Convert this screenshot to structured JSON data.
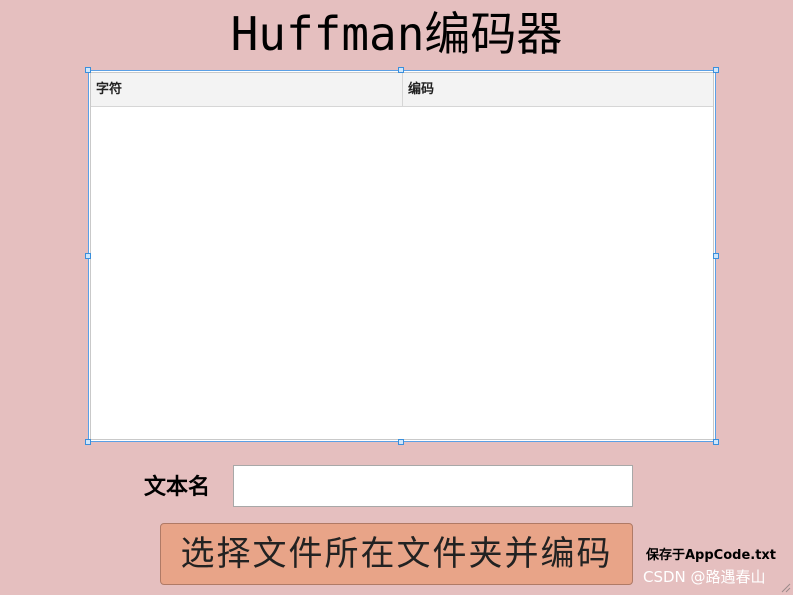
{
  "window": {
    "title": "Huffman编码器"
  },
  "table": {
    "columns": [
      "字符",
      "编码"
    ],
    "rows": []
  },
  "form": {
    "filename_label": "文本名",
    "filename_value": ""
  },
  "actions": {
    "choose_folder_label": "选择文件所在文件夹并编码",
    "save_note": "保存于AppCode.txt"
  },
  "watermark": "CSDN @路遇春山",
  "colors": {
    "background": "#e5bfbf",
    "button": "#e8a488",
    "selection_border": "#5aa0e6"
  },
  "icons": [
    "resize-grip-icon"
  ]
}
